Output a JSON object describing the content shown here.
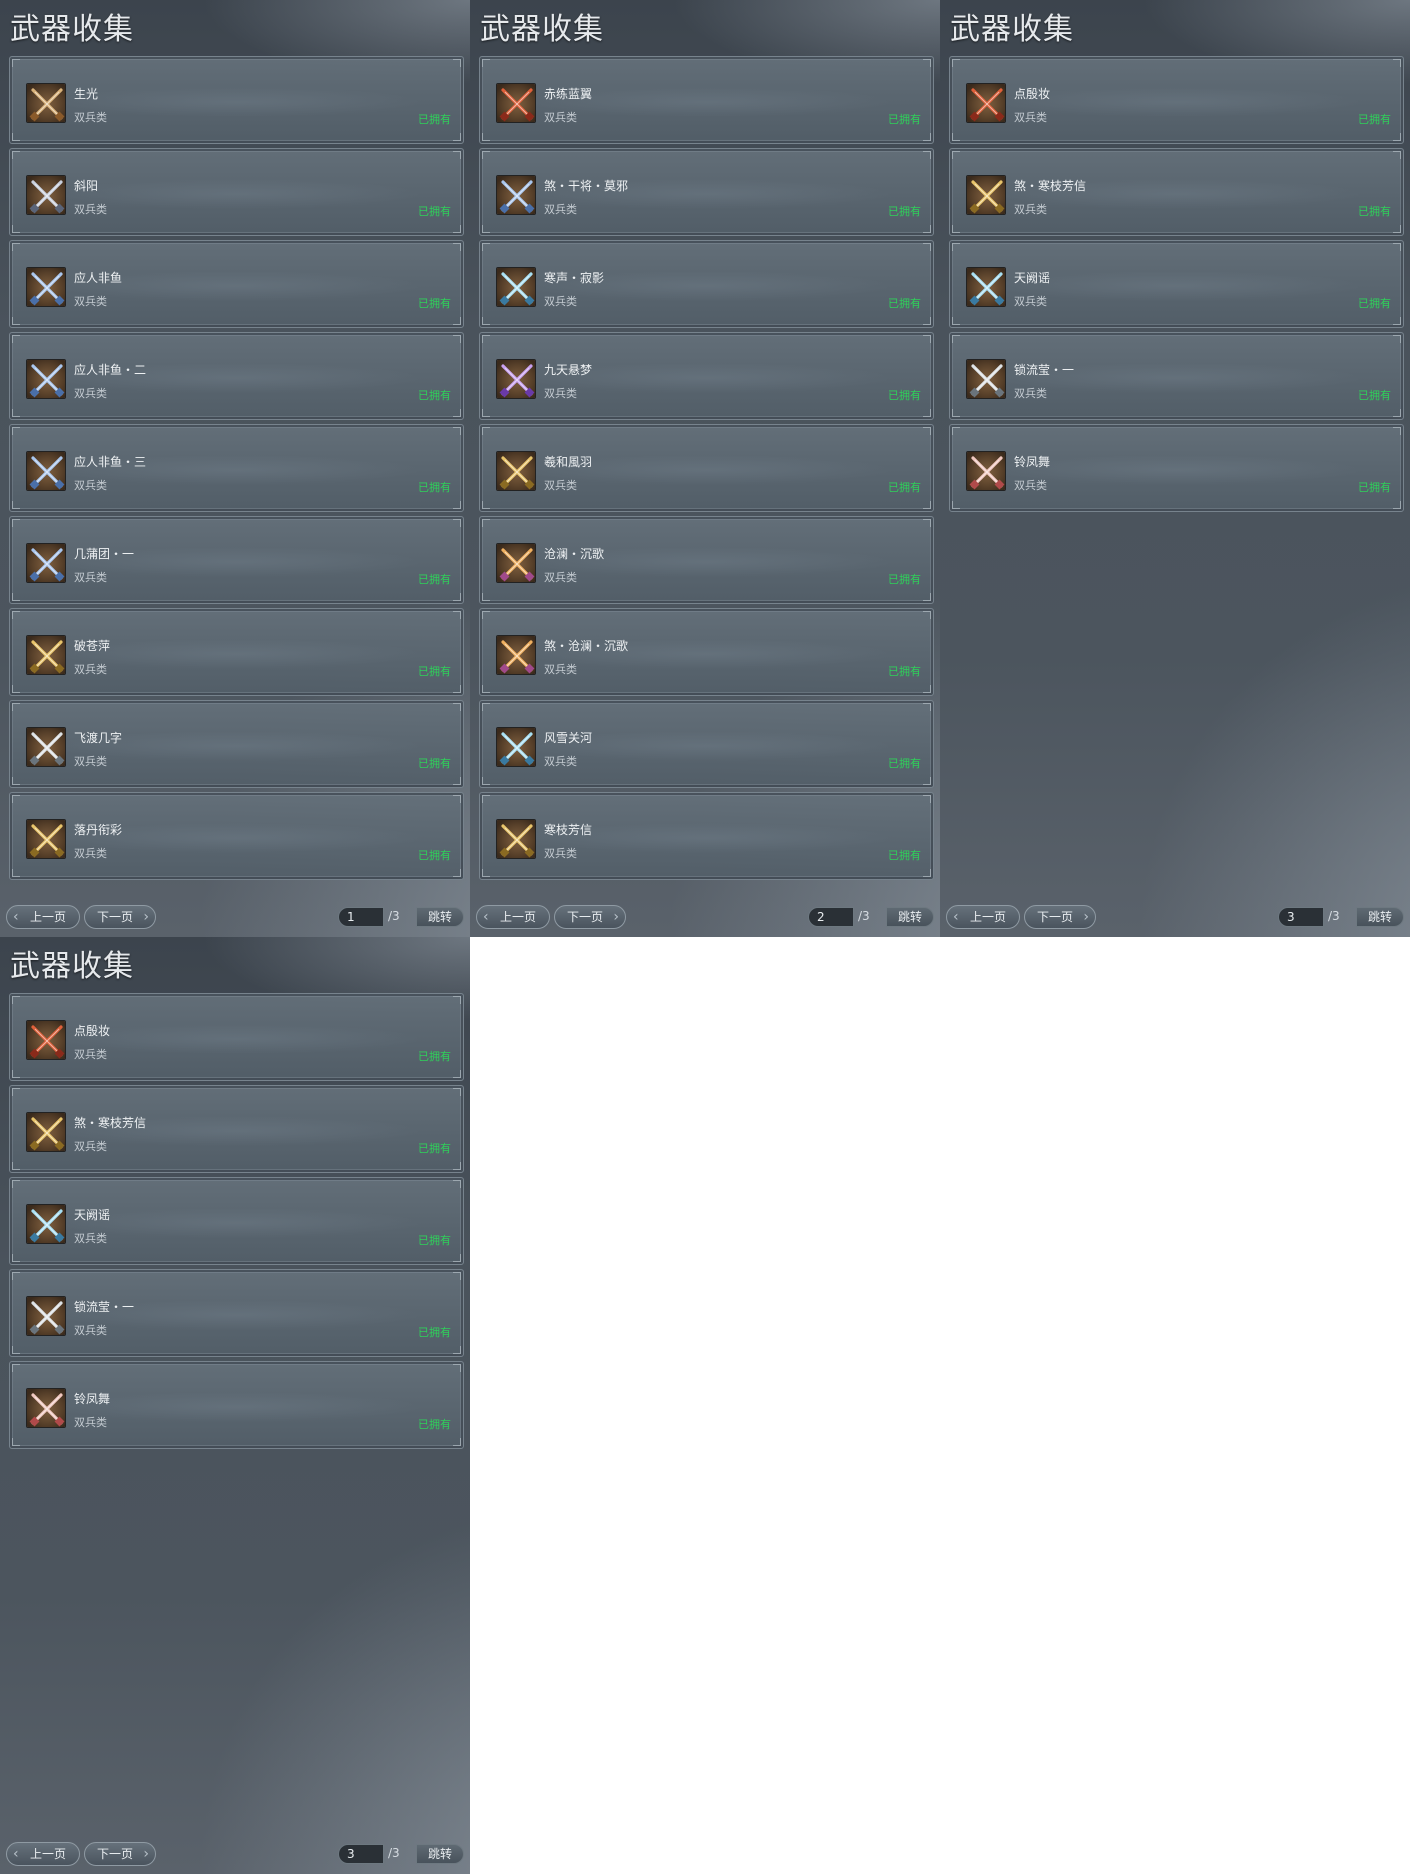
{
  "title": "武器收集",
  "type_label": "双兵类",
  "status_label": "已拥有",
  "pager": {
    "prev_label": "上一页",
    "next_label": "下一页",
    "total_label": "/3",
    "jump_label": "跳转"
  },
  "colors": {
    "owned": "#2fd05a",
    "panel_bg": "#4a535c",
    "card_border": "#77838d"
  },
  "panels": [
    {
      "page_value": "1",
      "items": [
        {
          "name": "生光",
          "icon": "crossed-blades-bronze-icon"
        },
        {
          "name": "斜阳",
          "icon": "crossed-blades-steel-icon"
        },
        {
          "name": "应人非鱼",
          "icon": "crossed-blades-blue-icon"
        },
        {
          "name": "应人非鱼・二",
          "icon": "crossed-blades-blue-icon"
        },
        {
          "name": "应人非鱼・三",
          "icon": "crossed-blades-blue-icon"
        },
        {
          "name": "几蒲团・一",
          "icon": "crossed-blades-blue-icon"
        },
        {
          "name": "破苍萍",
          "icon": "crossed-blades-gold-icon"
        },
        {
          "name": "飞渡几字",
          "icon": "crossed-blades-silver-icon"
        },
        {
          "name": "落丹衔彩",
          "icon": "crossed-blades-gold-icon"
        }
      ]
    },
    {
      "page_value": "2",
      "items": [
        {
          "name": "赤练蓝翼",
          "icon": "crossed-blades-red-icon"
        },
        {
          "name": "煞・干将・莫邪",
          "icon": "crossed-blades-blue-icon"
        },
        {
          "name": "寒声・寂影",
          "icon": "crossed-blades-ice-icon"
        },
        {
          "name": "九天悬梦",
          "icon": "crossed-blades-purple-icon"
        },
        {
          "name": "羲和風羽",
          "icon": "crossed-blades-gold-icon"
        },
        {
          "name": "沧澜・沉歌",
          "icon": "crossed-blades-orange-icon"
        },
        {
          "name": "煞・沧澜・沉歌",
          "icon": "crossed-blades-orange-icon"
        },
        {
          "name": "风雪关河",
          "icon": "crossed-blades-ice-icon"
        },
        {
          "name": "寒枝芳信",
          "icon": "crossed-blades-gold-icon"
        }
      ]
    },
    {
      "page_value": "3",
      "items": [
        {
          "name": "点殷妆",
          "icon": "crossed-blades-red-icon"
        },
        {
          "name": "煞・寒枝芳信",
          "icon": "crossed-blades-gold-icon"
        },
        {
          "name": "天阙谣",
          "icon": "crossed-blades-ice-icon"
        },
        {
          "name": "锁流莹・一",
          "icon": "crossed-blades-silver-icon"
        },
        {
          "name": "铃凤舞",
          "icon": "crossed-blades-pink-icon"
        }
      ]
    },
    {
      "page_value": "3",
      "items": [
        {
          "name": "点殷妆",
          "icon": "crossed-blades-red-icon"
        },
        {
          "name": "煞・寒枝芳信",
          "icon": "crossed-blades-gold-icon"
        },
        {
          "name": "天阙谣",
          "icon": "crossed-blades-ice-icon"
        },
        {
          "name": "锁流莹・一",
          "icon": "crossed-blades-silver-icon"
        },
        {
          "name": "铃凤舞",
          "icon": "crossed-blades-pink-icon"
        }
      ]
    }
  ]
}
